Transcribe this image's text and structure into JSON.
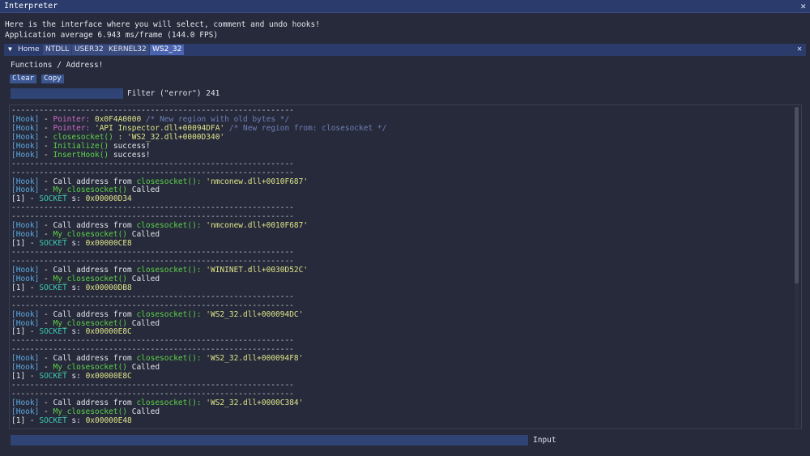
{
  "window": {
    "title": "Interpreter",
    "close_glyph": "✕"
  },
  "header": {
    "line1": "Here is the interface where you will select, comment and undo hooks!",
    "line2": "Application average 6.943 ms/frame (144.0 FPS)"
  },
  "tabs": {
    "toggle_icon": "▼",
    "items": [
      {
        "label": "Home"
      },
      {
        "label": "NTDLL"
      },
      {
        "label": "USER32"
      },
      {
        "label": "KERNEL32"
      },
      {
        "label": "WS2_32"
      }
    ],
    "close_glyph": "✕"
  },
  "panel": {
    "label": "Functions / Address!"
  },
  "buttons": {
    "clear": "Clear",
    "copy": "Copy"
  },
  "filter": {
    "label": "Filter (\"error\") 241",
    "value": ""
  },
  "separator": "-------------------------------------------------------------",
  "init_block": {
    "hook_tag": "[Hook]",
    "dash": " - ",
    "pointer_label": "Pointer:",
    "pointer_value": " 0x0F4A0000",
    "pointer_comment": " /* New region with old bytes */",
    "pointer2_value": " 'API Inspector.dll+00094DFA'",
    "pointer2_comment": " /* New region from: closesocket */",
    "closesocket_fn": "closesocket()",
    "closesocket_value": " : 'WS2_32.dll+0000D340'",
    "initialize_fn": "Initialize()",
    "insert_fn": "InsertHook()",
    "success": " success!"
  },
  "call_block": {
    "hook_tag": "[Hook]",
    "dash": " - ",
    "call_prefix": "Call address from ",
    "call_fn": "closesocket():",
    "my_fn": "My_closesocket()",
    "called": " Called",
    "index_tag": "[1]",
    "socket_type": "SOCKET",
    "socket_prefix": " s: "
  },
  "calls": [
    {
      "address": " 'nmconew.dll+0010F687'",
      "socket": "0x00000D34"
    },
    {
      "address": " 'nmconew.dll+0010F687'",
      "socket": "0x00000CE8"
    },
    {
      "address": " 'WININET.dll+0030D52C'",
      "socket": "0x00000DB8"
    },
    {
      "address": " 'WS2_32.dll+000094DC'",
      "socket": "0x00000E8C"
    },
    {
      "address": " 'WS2_32.dll+000094F8'",
      "socket": "0x00000E8C"
    },
    {
      "address": " 'WS2_32.dll+0000C384'",
      "socket": "0x00000E48"
    }
  ],
  "input": {
    "label": "Input",
    "value": ""
  },
  "colors": {
    "background": "#262a3a",
    "titlebar": "#2b3b6c",
    "hook_tag": "#5fa9e0",
    "pointer": "#d06cc4",
    "address": "#dfe48a",
    "function": "#5fd24a",
    "socket_type": "#3ec9b0",
    "comment": "#6f7fb8"
  }
}
